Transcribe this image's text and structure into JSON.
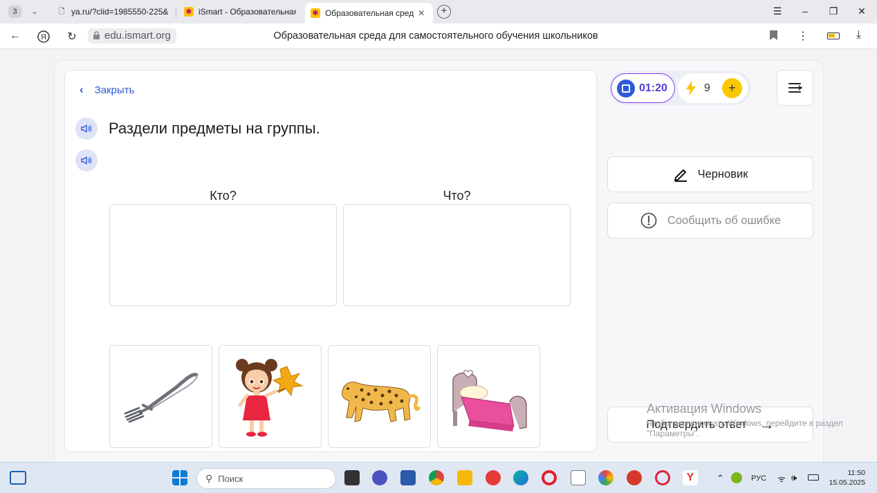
{
  "browser": {
    "tab_count": "3",
    "tabs": [
      {
        "title": "ya.ru/?clid=1985550-225&",
        "icon": "page-icon"
      },
      {
        "title": "iSmart - Образовательная",
        "icon": "ismart-icon"
      },
      {
        "title": "Образовательная сред",
        "icon": "ismart-icon",
        "active": true
      }
    ],
    "address": "edu.ismart.org",
    "page_title": "Образовательная среда для самостоятельного обучения школьников"
  },
  "task": {
    "close_label": "Закрыть",
    "title": "Раздели предметы на группы.",
    "groups": [
      {
        "label": "Кто?"
      },
      {
        "label": "Что?"
      }
    ],
    "items": [
      "fork",
      "girl",
      "leopard",
      "bed"
    ]
  },
  "sidebar": {
    "timer": "01:20",
    "energy": "9",
    "draft_label": "Черновик",
    "report_label": "Сообщить об ошибке",
    "confirm_label": "Подтвердить ответ"
  },
  "watermark": {
    "line1": "Активация Windows",
    "line2": "Чтобы активировать Windows, перейдите в раздел \"Параметры\"."
  },
  "taskbar": {
    "search_placeholder": "Поиск",
    "lang": "РУС",
    "time": "11:50",
    "date": "15.05.2025"
  },
  "colors": {
    "accent_blue": "#2f5bd8",
    "timer_border": "#7c3aed",
    "energy_yellow": "#f9c800"
  }
}
